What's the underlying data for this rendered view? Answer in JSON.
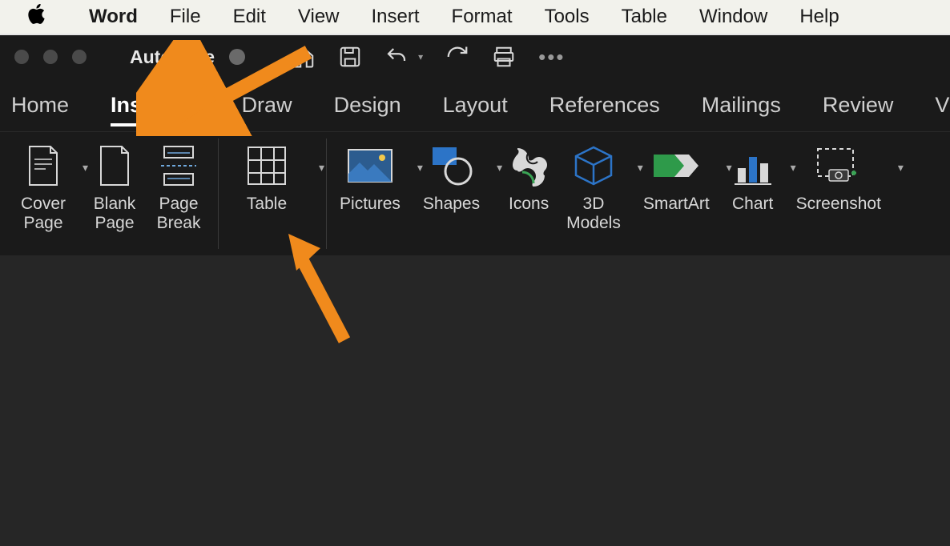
{
  "menubar": {
    "appName": "Word",
    "items": [
      "File",
      "Edit",
      "View",
      "Insert",
      "Format",
      "Tools",
      "Table",
      "Window",
      "Help"
    ]
  },
  "titlebar": {
    "autosave": "AutoSave"
  },
  "ribbonTabs": [
    "Home",
    "Insert",
    "Draw",
    "Design",
    "Layout",
    "References",
    "Mailings",
    "Review",
    "View"
  ],
  "activeTab": "Insert",
  "ribbon": {
    "coverPage": "Cover\nPage",
    "blankPage": "Blank\nPage",
    "pageBreak": "Page\nBreak",
    "table": "Table",
    "pictures": "Pictures",
    "shapes": "Shapes",
    "icons": "Icons",
    "models3d": "3D\nModels",
    "smartart": "SmartArt",
    "chart": "Chart",
    "screenshot": "Screenshot"
  }
}
